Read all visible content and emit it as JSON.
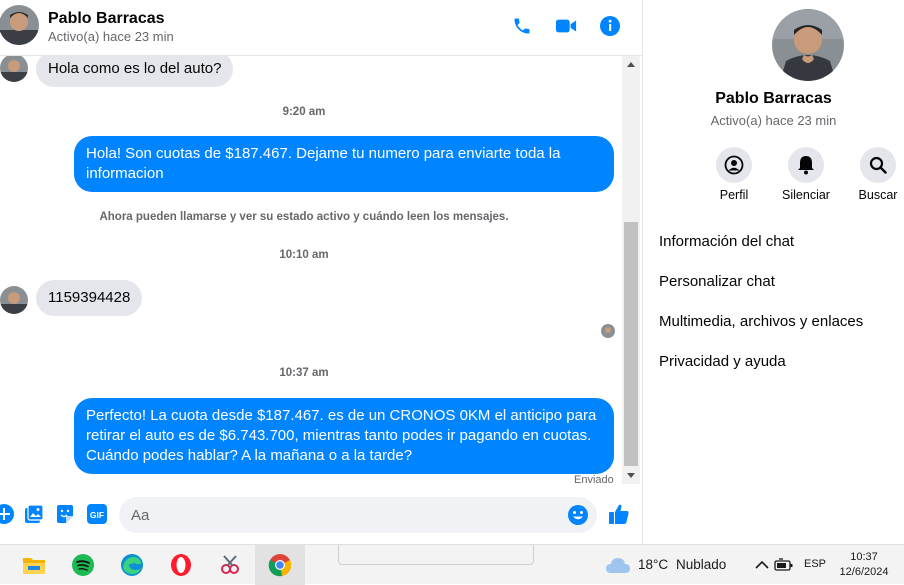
{
  "header": {
    "name": "Pablo Barracas",
    "status": "Activo(a) hace 23 min"
  },
  "messages": {
    "m1_text": "Hola como es lo del auto?",
    "t1": "9:20 am",
    "m2_text": "Hola! Son cuotas de $187.467. Dejame tu numero para enviarte toda la informacion",
    "sys": "Ahora pueden llamarse y ver su estado activo y cuándo leen los mensajes.",
    "t2": "10:10 am",
    "m3_text": "1159394428",
    "t3": "10:37 am",
    "m4_text": "Perfecto! La cuota desde $187.467. es de un CRONOS 0KM el anticipo para retirar el auto es de $6.743.700, mientras tanto podes ir pagando en cuotas. Cuándo podes hablar? A la mañana o a la tarde?",
    "sent_label": "Enviado"
  },
  "composer": {
    "placeholder": "Aa"
  },
  "panel": {
    "name": "Pablo Barracas",
    "status": "Activo(a) hace 23 min",
    "actions": [
      "Perfil",
      "Silenciar",
      "Buscar"
    ],
    "menu": [
      "Información del chat",
      "Personalizar chat",
      "Multimedia, archivos y enlaces",
      "Privacidad y ayuda"
    ]
  },
  "taskbar": {
    "temp": "18°C",
    "weather": "Nublado",
    "lang": "ESP",
    "time": "10:37",
    "date": "12/6/2024"
  },
  "colors": {
    "accent": "#0084ff",
    "bubble_in": "#e4e6eb"
  },
  "icons": [
    "phone-icon",
    "video-icon",
    "info-icon",
    "add-icon",
    "image-icon",
    "sticker-icon",
    "gif-icon",
    "emoji-icon",
    "like-icon",
    "profile-icon",
    "bell-icon",
    "search-icon",
    "file-explorer-icon",
    "spotify-icon",
    "edge-icon",
    "opera-icon",
    "snipping-icon",
    "chrome-icon",
    "cloud-icon",
    "wifi-icon",
    "battery-icon"
  ]
}
